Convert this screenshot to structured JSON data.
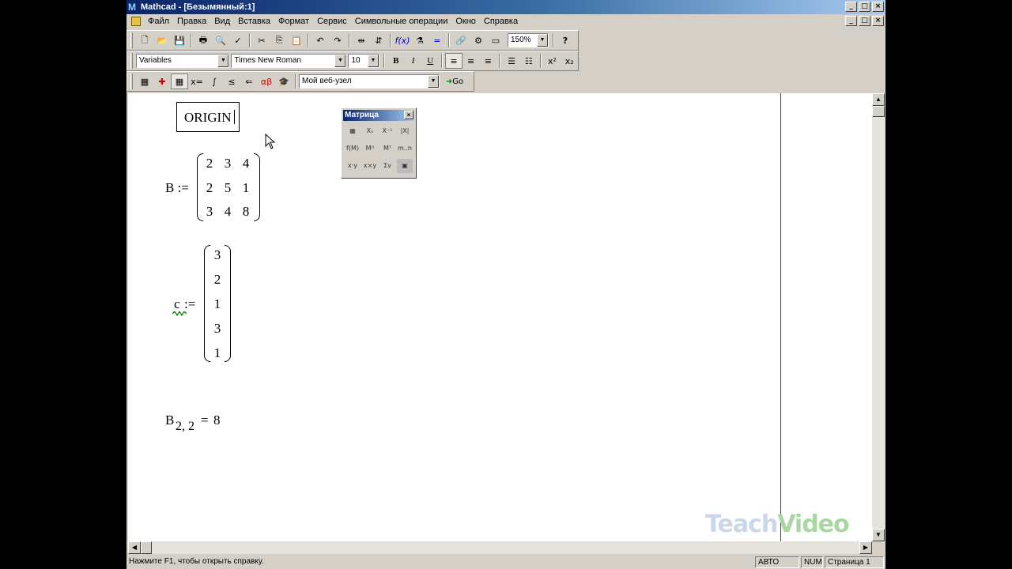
{
  "window": {
    "title": "Mathcad - [Безымянный:1]"
  },
  "window_controls": {
    "minimize": "_",
    "maximize": "□",
    "close": "×"
  },
  "menu": [
    "Файл",
    "Правка",
    "Вид",
    "Вставка",
    "Формат",
    "Сервис",
    "Символьные операции",
    "Окно",
    "Справка"
  ],
  "toolbar_standard": {
    "zoom": "150%"
  },
  "toolbar_formatting": {
    "style": "Variables",
    "font": "Times New Roman",
    "size": "10",
    "bold": "B",
    "italic": "I",
    "underline": "U"
  },
  "toolbar_resources": {
    "web_combo": "Мой веб-узел",
    "go_label": "Go"
  },
  "worksheet": {
    "origin_text": "ORIGIN",
    "matrix_b": {
      "name": "B :=",
      "rows": [
        [
          "2",
          "3",
          "4"
        ],
        [
          "2",
          "5",
          "1"
        ],
        [
          "3",
          "4",
          "8"
        ]
      ]
    },
    "vector_c": {
      "name": "c",
      "assign": ":=",
      "values": [
        "3",
        "2",
        "1",
        "3",
        "1"
      ]
    },
    "eval": {
      "name": "B",
      "subscript": "2, 2",
      "equals": "=",
      "result": "8"
    }
  },
  "palette": {
    "title": "Матрица",
    "close": "×"
  },
  "watermark": {
    "part1": "Teach",
    "part2": "Video"
  },
  "status": {
    "help": "Нажмите F1, чтобы открыть справку.",
    "mode": "АВТО",
    "num": "NUM",
    "page": "Страница 1"
  }
}
